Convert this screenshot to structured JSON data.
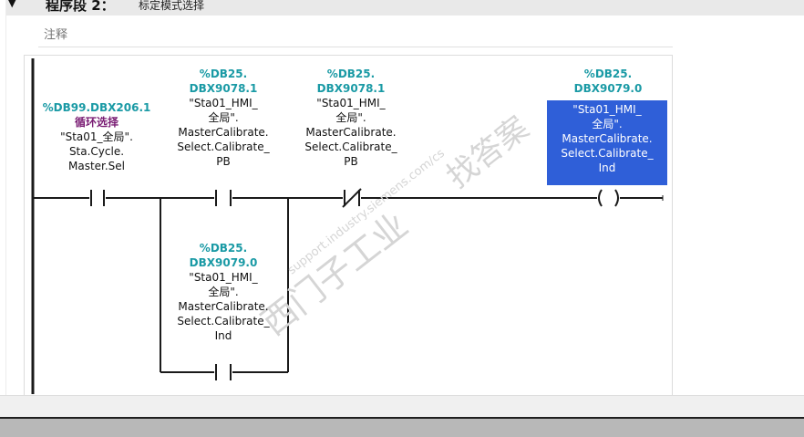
{
  "network": {
    "arrow": "▼",
    "title": "程序段 2：",
    "subtitle": "标定模式选择",
    "comment_placeholder": "注释"
  },
  "contacts": [
    {
      "address": "%DB99.DBX206.1",
      "symbol": "循环选择",
      "tag": [
        "\"Sta01_全局\".",
        "Sta.Cycle.",
        "Master.Sel"
      ],
      "type": "NO"
    },
    {
      "address": [
        "%DB25.",
        "DBX9078.1"
      ],
      "tag": [
        "\"Sta01_HMI_",
        "全局\".",
        "MasterCalibrate.",
        "Select.Calibrate_",
        "PB"
      ],
      "type": "NO"
    },
    {
      "address": [
        "%DB25.",
        "DBX9078.1"
      ],
      "tag": [
        "\"Sta01_HMI_",
        "全局\".",
        "MasterCalibrate.",
        "Select.Calibrate_",
        "PB"
      ],
      "type": "NC"
    },
    {
      "address": [
        "%DB25.",
        "DBX9079.0"
      ],
      "tag": [
        "\"Sta01_HMI_",
        "全局\".",
        "MasterCalibrate.",
        "Select.Calibrate_",
        "Ind"
      ],
      "type": "NO",
      "branch": true
    }
  ],
  "coil": {
    "address": [
      "%DB25.",
      "DBX9079.0"
    ],
    "tag": [
      "\"Sta01_HMI_",
      "全局\".",
      "MasterCalibrate.",
      "Select.Calibrate_",
      "Ind"
    ],
    "selected": true
  },
  "watermark": {
    "line1": "西门子工业",
    "line2": "support.industry.siemens.com/cs",
    "line3": "找答案"
  }
}
